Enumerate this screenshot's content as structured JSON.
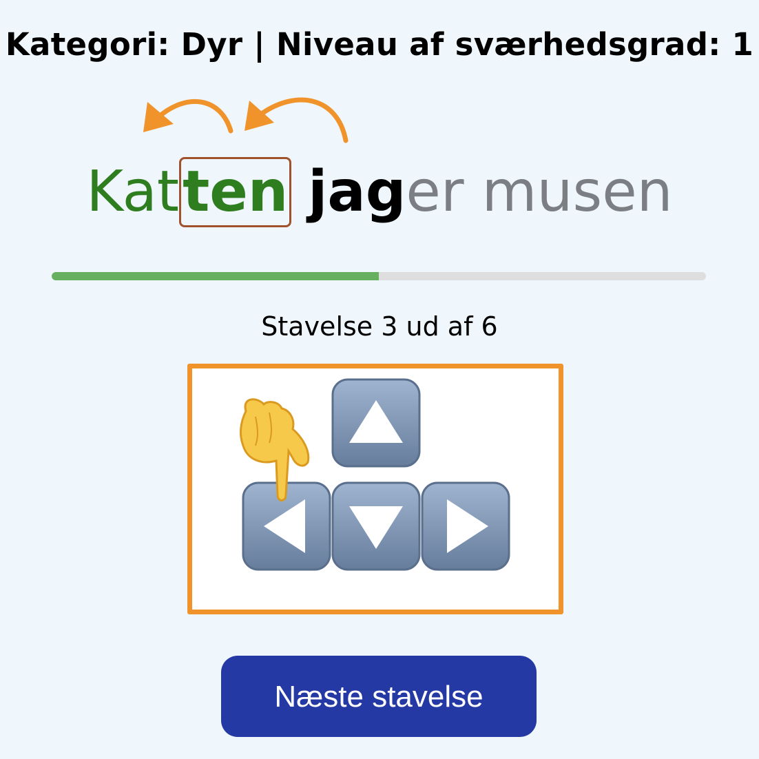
{
  "header": {
    "title": "Kategori: Dyr | Niveau af sværhedsgrad: 1"
  },
  "sentence": {
    "segments": [
      {
        "text": "Kat",
        "state": "done"
      },
      {
        "text": "ten",
        "state": "current"
      },
      {
        "text": "jag",
        "state": "active"
      },
      {
        "text": "er musen",
        "state": "pending"
      }
    ]
  },
  "progress": {
    "fraction": 0.5
  },
  "counter": {
    "label": "Stavelse 3 ud af 6"
  },
  "hint": {
    "icons": [
      "pointing-finger-icon",
      "arrow-up-key-icon",
      "arrow-left-key-icon",
      "arrow-down-key-icon",
      "arrow-right-key-icon"
    ]
  },
  "actions": {
    "next_label": "Næste stavelse"
  },
  "colors": {
    "background": "#eff6fc",
    "done": "#2e7d1e",
    "current_box": "#a0522d",
    "pending": "#7b7f84",
    "progress_fill": "#66b05f",
    "progress_track": "#dedede",
    "frame": "#f0932b",
    "button": "#2539a5",
    "arrows": "#f0932b"
  }
}
